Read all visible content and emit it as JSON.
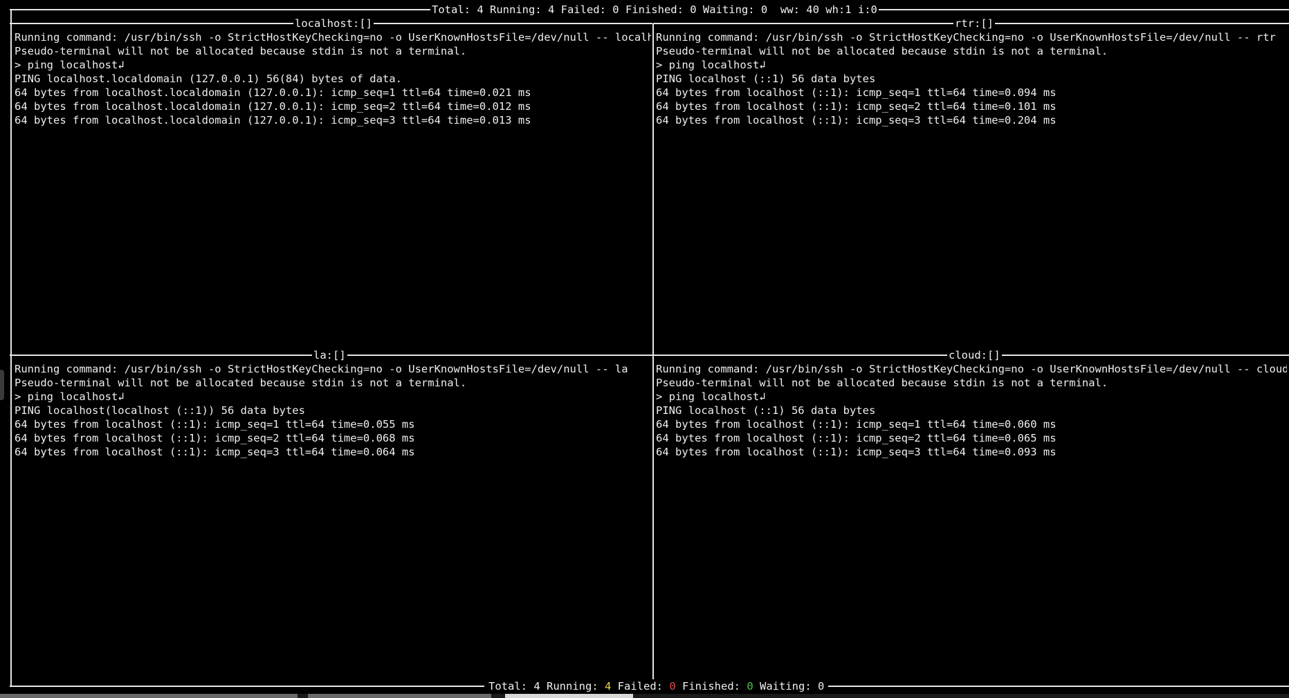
{
  "status_top": "Total: 4 Running: 4 Failed: 0 Finished: 0 Waiting: 0  ww: 40 wh:1 i:0",
  "status_bottom": {
    "total_label": "Total: ",
    "total_value": "4",
    "running_label": " Running: ",
    "running_value": "4",
    "failed_label": " Failed: ",
    "failed_value": "0",
    "finished_label": " Finished: ",
    "finished_value": "0",
    "waiting_label": " Waiting: ",
    "waiting_value": "0"
  },
  "panes": [
    {
      "title": "localhost:[]",
      "lines": [
        "Running command: /usr/bin/ssh -o StrictHostKeyChecking=no -o UserKnownHostsFile=/dev/null -- localhost",
        "Pseudo-terminal will not be allocated because stdin is not a terminal.",
        "> ping localhost↲",
        "PING localhost.localdomain (127.0.0.1) 56(84) bytes of data.",
        "64 bytes from localhost.localdomain (127.0.0.1): icmp_seq=1 ttl=64 time=0.021 ms",
        "64 bytes from localhost.localdomain (127.0.0.1): icmp_seq=2 ttl=64 time=0.012 ms",
        "64 bytes from localhost.localdomain (127.0.0.1): icmp_seq=3 ttl=64 time=0.013 ms"
      ]
    },
    {
      "title": "rtr:[]",
      "lines": [
        "Running command: /usr/bin/ssh -o StrictHostKeyChecking=no -o UserKnownHostsFile=/dev/null -- rtr",
        "Pseudo-terminal will not be allocated because stdin is not a terminal.",
        "> ping localhost↲",
        "PING localhost (::1) 56 data bytes",
        "64 bytes from localhost (::1): icmp_seq=1 ttl=64 time=0.094 ms",
        "64 bytes from localhost (::1): icmp_seq=2 ttl=64 time=0.101 ms",
        "64 bytes from localhost (::1): icmp_seq=3 ttl=64 time=0.204 ms"
      ]
    },
    {
      "title": "la:[]",
      "lines": [
        "Running command: /usr/bin/ssh -o StrictHostKeyChecking=no -o UserKnownHostsFile=/dev/null -- la",
        "Pseudo-terminal will not be allocated because stdin is not a terminal.",
        "> ping localhost↲",
        "PING localhost(localhost (::1)) 56 data bytes",
        "64 bytes from localhost (::1): icmp_seq=1 ttl=64 time=0.055 ms",
        "64 bytes from localhost (::1): icmp_seq=2 ttl=64 time=0.068 ms",
        "64 bytes from localhost (::1): icmp_seq=3 ttl=64 time=0.064 ms"
      ]
    },
    {
      "title": "cloud:[]",
      "lines": [
        "Running command: /usr/bin/ssh -o StrictHostKeyChecking=no -o UserKnownHostsFile=/dev/null -- cloud",
        "Pseudo-terminal will not be allocated because stdin is not a terminal.",
        "> ping localhost↲",
        "PING localhost (::1) 56 data bytes",
        "64 bytes from localhost (::1): icmp_seq=1 ttl=64 time=0.060 ms",
        "64 bytes from localhost (::1): icmp_seq=2 ttl=64 time=0.065 ms",
        "64 bytes from localhost (::1): icmp_seq=3 ttl=64 time=0.093 ms"
      ]
    }
  ],
  "colors": {
    "background": "#000000",
    "foreground": "#e6e6e6",
    "running": "#e6d34a",
    "failed": "#e05050",
    "finished": "#4ec24e"
  }
}
